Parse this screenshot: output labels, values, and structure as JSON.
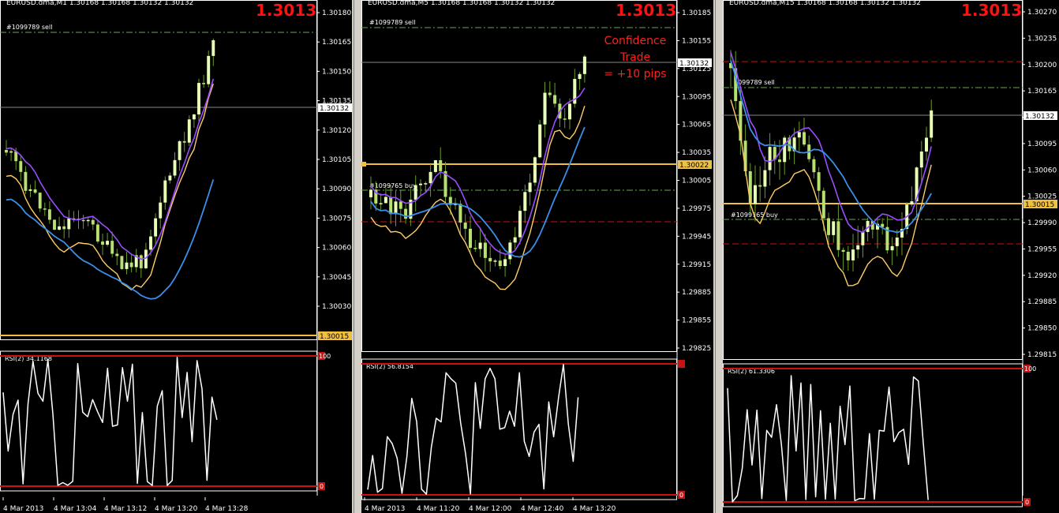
{
  "colors": {
    "background": "#000000",
    "bull_candle": "#e8ffb8",
    "bear_candle": "#b8e070",
    "wick": "#6a9a2a",
    "ma_fast": "#ffcc66",
    "ma_mid": "#9b4dff",
    "ma_slow": "#3a8fe8",
    "rsi_line": "#ffffff",
    "rsi_band": "#cc1111",
    "price_label_bg": "#f0c040",
    "bid_label_bg": "#ffffff",
    "big_price": "#ff1111",
    "axis_text": "#ffffff",
    "grid_level": "#888888",
    "annotation_text": "#ff2020"
  },
  "windows": [
    {
      "id": "m1",
      "title": "EURUSD.dma,M1  1.30168 1.30168 1.30132 1.30132",
      "big_price": "1.3013",
      "order_sell": "#1099789 sell",
      "order_buy": "",
      "price_ticks": [
        "1.30180",
        "1.30165",
        "1.30150",
        "1.30135",
        "1.30120",
        "1.30105",
        "1.30090",
        "1.30075",
        "1.30060",
        "1.30045",
        "1.30030"
      ],
      "bid_label": "1.30132",
      "yellow_label": "1.30015",
      "rsi_title": "RSI(2) 34.1168",
      "rsi_top": "100",
      "rsi_bottom": "0",
      "time_ticks": [
        "4 Mar 2013",
        "4 Mar 13:04",
        "4 Mar 13:12",
        "4 Mar 13:20",
        "4 Mar 13:28"
      ],
      "annotation": []
    },
    {
      "id": "m5",
      "title": "EURUSD.dma,M5  1.30168 1.30168 1.30132 1.30132",
      "big_price": "1.3013",
      "order_sell": "#1099789 sell",
      "order_buy": "#1099765 buy",
      "price_ticks": [
        "1.30185",
        "1.30155",
        "1.30125",
        "1.30095",
        "1.30065",
        "1.30035",
        "1.30005",
        "1.29975",
        "1.29945",
        "1.29915",
        "1.29885",
        "1.29855",
        "1.29825"
      ],
      "bid_label": "1.30132",
      "yellow_label": "1.30022",
      "rsi_title": "RSI(2) 56.8154",
      "rsi_top": "",
      "rsi_bottom": "0",
      "time_ticks": [
        "4 Mar 2013",
        "4 Mar 11:20",
        "4 Mar 12:00",
        "4 Mar 12:40",
        "4 Mar 13:20"
      ],
      "annotation": [
        "Confidence",
        "Trade",
        "= +10 pips"
      ]
    },
    {
      "id": "m15",
      "title": "EURUSD.dma,M15  1.30168 1.30168 1.30132 1.30132",
      "big_price": "1.3013",
      "order_sell": "1099789 sell",
      "order_buy": "#1099765 buy",
      "price_ticks": [
        "1.30270",
        "1.30235",
        "1.30200",
        "1.30165",
        "1.30130",
        "1.30095",
        "1.30060",
        "1.30025",
        "1.29990",
        "1.29955",
        "1.29920",
        "1.29885",
        "1.29850",
        "1.29815"
      ],
      "bid_label": "1.30132",
      "yellow_label": "1.30015",
      "rsi_title": "RSI(2) 61.3306",
      "rsi_top": "100",
      "rsi_bottom": "0",
      "time_ticks": [],
      "annotation": []
    }
  ]
}
